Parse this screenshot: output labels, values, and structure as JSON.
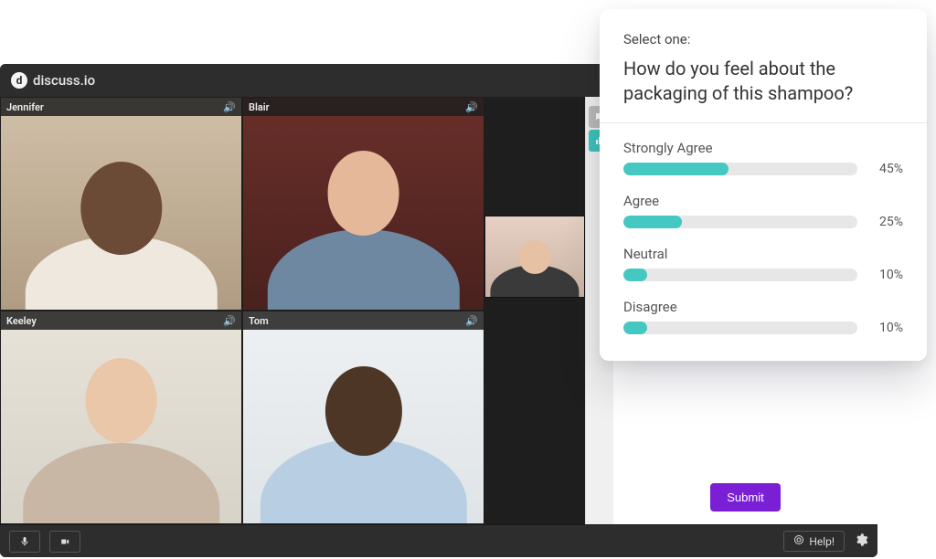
{
  "brand": {
    "name": "discuss.io"
  },
  "participants": [
    {
      "name": "Jennifer"
    },
    {
      "name": "Blair"
    },
    {
      "name": "Keeley"
    },
    {
      "name": "Tom"
    }
  ],
  "bottom_bar": {
    "help_label": "Help!"
  },
  "panel": {
    "submit_label": "Submit"
  },
  "poll": {
    "kicker": "Select one:",
    "question": "How do you feel about the packaging of this shampoo?",
    "options": [
      {
        "label": "Strongly Agree",
        "pct_label": "45%"
      },
      {
        "label": "Agree",
        "pct_label": "25%"
      },
      {
        "label": "Neutral",
        "pct_label": "10%"
      },
      {
        "label": "Disagree",
        "pct_label": "10%"
      }
    ]
  },
  "chart_data": {
    "type": "bar",
    "title": "How do you feel about the packaging of this shampoo?",
    "categories": [
      "Strongly Agree",
      "Agree",
      "Neutral",
      "Disagree"
    ],
    "values": [
      45,
      25,
      10,
      10
    ],
    "xlabel": "",
    "ylabel": "Percent",
    "ylim": [
      0,
      100
    ]
  }
}
